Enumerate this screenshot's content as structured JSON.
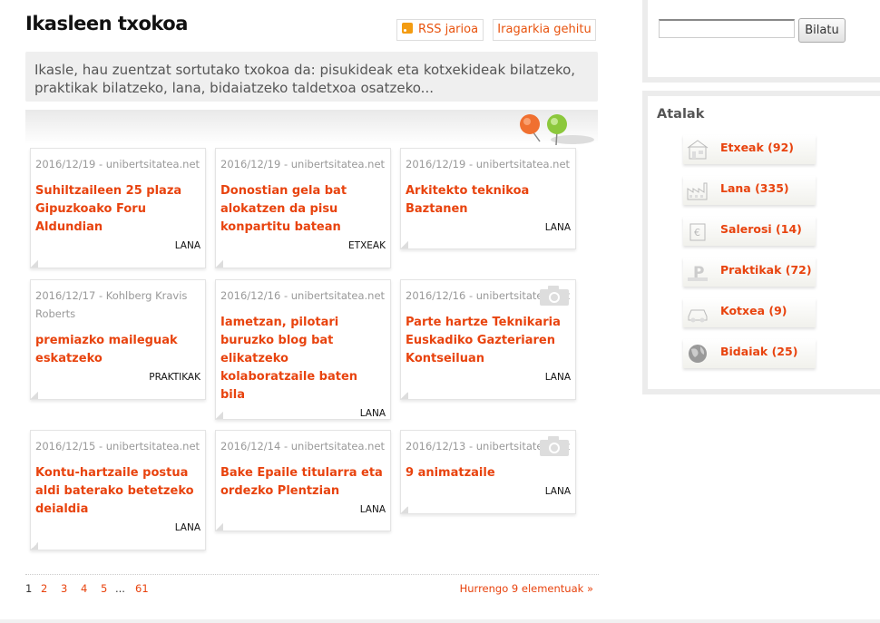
{
  "page": {
    "title": "Ikasleen txokoa",
    "rss_label": "RSS jarioa",
    "add_label": "Iragarkia gehitu",
    "intro": "Ikasle, hau zuentzat sortutako txokoa da: pisukideak eta kotxekideak bilatzeko, praktikak bilatzeko, lana, bidaiatzeko taldetxoa osatzeko..."
  },
  "cards": [
    {
      "meta": "2016/12/19 - unibertsitatea.net",
      "title": "Suhiltzaileen 25 plaza Gipuzkoako Foru Aldundian",
      "category": "LANA",
      "camera": false
    },
    {
      "meta": "2016/12/19 - unibertsitatea.net",
      "title": "Donostian gela bat alokatzen da pisu konpartitu batean",
      "category": "ETXEAK",
      "camera": false
    },
    {
      "meta": "2016/12/19 - unibertsitatea.net",
      "title": "Arkitekto teknikoa Baztanen",
      "category": "LANA",
      "camera": false
    },
    {
      "meta": "2016/12/17 - Kohlberg Kravis Roberts",
      "title": "premiazko maileguak eskatzeko",
      "category": "PRAKTIKAK",
      "camera": false
    },
    {
      "meta": "2016/12/16 - unibertsitatea.net",
      "title": "Iametzan, pilotari buruzko blog bat elikatzeko kolaboratzaile baten bila",
      "category": "LANA",
      "camera": false
    },
    {
      "meta": "2016/12/16 - unibertsitatea.net",
      "title": "Parte hartze Teknikaria Euskadiko Gazteriaren Kontseiluan",
      "category": "LANA",
      "camera": true
    },
    {
      "meta": "2016/12/15 - unibertsitatea.net",
      "title": "Kontu-hartzaile postua aldi baterako betetzeko deialdia",
      "category": "LANA",
      "camera": false
    },
    {
      "meta": "2016/12/14 - unibertsitatea.net",
      "title": "Bake Epaile titularra eta ordezko Plentzian",
      "category": "LANA",
      "camera": false
    },
    {
      "meta": "2016/12/13 - unibertsitatea.net",
      "title": "9 animatzaile",
      "category": "LANA",
      "camera": true
    }
  ],
  "pager": {
    "pages": [
      "1",
      "2",
      "3",
      "4",
      "5",
      "...",
      "61"
    ],
    "current": "1",
    "next_label": "Hurrengo 9 elementuak »"
  },
  "sidebar": {
    "search_value": "",
    "search_button": "Bilatu",
    "categories_title": "Atalak",
    "categories": [
      {
        "label": "Etxeak (92)",
        "icon": "house-icon"
      },
      {
        "label": "Lana (335)",
        "icon": "factory-icon"
      },
      {
        "label": "Salerosi (14)",
        "icon": "price-tag-icon"
      },
      {
        "label": "Praktikak (72)",
        "icon": "letter-p-icon"
      },
      {
        "label": "Kotxea (9)",
        "icon": "car-icon"
      },
      {
        "label": "Bidaiak (25)",
        "icon": "globe-icon"
      }
    ]
  },
  "colors": {
    "accent": "#e8430e",
    "box_border": "#ececec"
  }
}
